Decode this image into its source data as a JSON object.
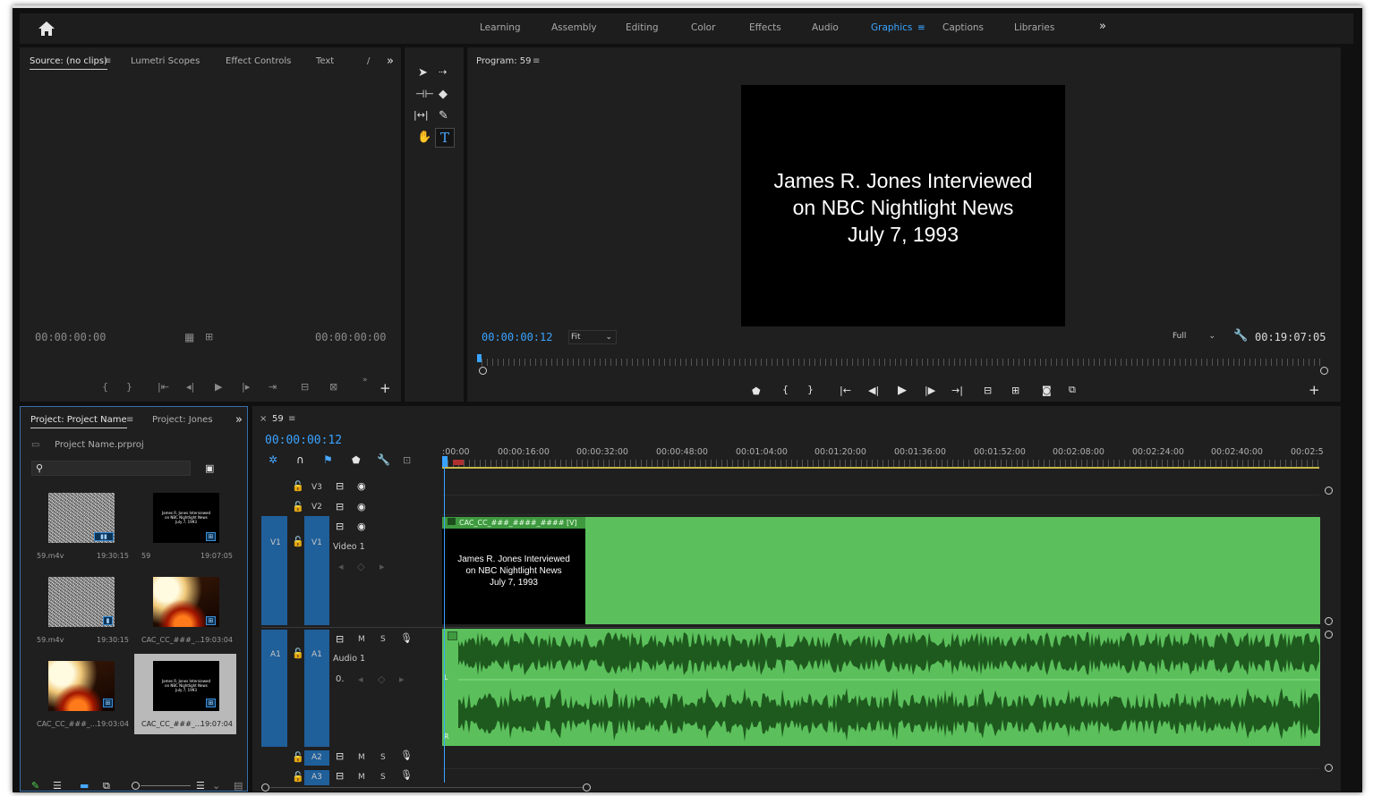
{
  "workspaces": {
    "items": [
      "Learning",
      "Assembly",
      "Editing",
      "Color",
      "Effects",
      "Audio",
      "Graphics",
      "Captions",
      "Libraries"
    ],
    "active": "Graphics",
    "more_glyph": "»"
  },
  "source_panel": {
    "tabs": [
      "Source: (no clips)",
      "Lumetri Scopes",
      "Effect Controls",
      "Text"
    ],
    "menu_glyph": "≡",
    "more_glyph": "»",
    "tc_left": "00:00:00:00",
    "tc_right": "00:00:00:00"
  },
  "program_panel": {
    "title": "Program: 59",
    "menu_glyph": "≡",
    "tc_current": "00:00:00:12",
    "zoom": "Fit",
    "quality": "Full",
    "tc_duration": "00:19:07:05",
    "frame_lines": [
      "James R. Jones Interviewed",
      "on NBC Nightlight News",
      "July 7, 1993"
    ]
  },
  "project_panel": {
    "tabs": [
      "Project: Project Name",
      "Project: Jones"
    ],
    "menu_glyph": "≡",
    "more_glyph": "»",
    "file_name": "Project Name.prproj",
    "thumbnails": [
      {
        "name": "59.m4v",
        "duration": "19:30:15"
      },
      {
        "name": "59",
        "duration": "19:07:05"
      },
      {
        "name": "59.m4v",
        "duration": "19:30:15"
      },
      {
        "name": "CAC_CC_###_...",
        "duration": "19:03:04"
      },
      {
        "name": "CAC_CC_###_...",
        "duration": "19:03:04"
      },
      {
        "name": "CAC_CC_###_...",
        "duration": "19:07:04"
      }
    ],
    "thumb_title_lines": [
      "James R. Jones Interviewed",
      "on NBC Nightlight News",
      "July 7, 1993"
    ]
  },
  "timeline": {
    "close_glyph": "×",
    "sequence_name": "59",
    "menu_glyph": "≡",
    "timecode": "00:00:00:12",
    "ticks": [
      ":00:00",
      "00:00:16:00",
      "00:00:32:00",
      "00:00:48:00",
      "00:01:04:00",
      "00:01:20:00",
      "00:01:36:00",
      "00:01:52:00",
      "00:02:08:00",
      "00:02:24:00",
      "00:02:40:00",
      "00:02:5"
    ],
    "tracks": {
      "v3": "V3",
      "v2": "V2",
      "v1": "V1",
      "v1_src": "V1",
      "video1": "Video 1",
      "a1": "A1",
      "a1_src": "A1",
      "audio1": "Audio 1",
      "a2": "A2",
      "a3": "A3",
      "m": "M",
      "s": "S",
      "vol": "0."
    },
    "clip_name": "CAC_CC_###_####_#### [V]",
    "clip_text_lines": [
      "James R. Jones Interviewed",
      "on NBC Nightlight News",
      "July 7, 1993"
    ],
    "channel_left": "L",
    "channel_right": "R"
  },
  "colors": {
    "accent": "#3aa3ff",
    "clip_green": "#5bc05b",
    "track_blue": "#1f5f9a"
  }
}
